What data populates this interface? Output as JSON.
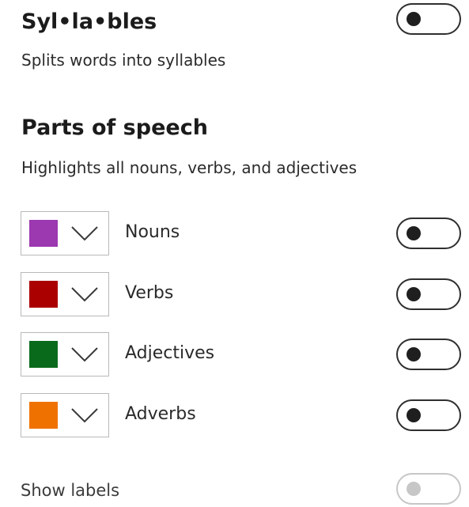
{
  "syllables": {
    "title": "Syl•la•bles",
    "description": "Splits words into syllables",
    "toggle_on": false
  },
  "parts_of_speech": {
    "title": "Parts of speech",
    "description": "Highlights all nouns, verbs, and adjectives",
    "items": [
      {
        "label": "Nouns",
        "color": "#9c38b0",
        "toggle_on": false
      },
      {
        "label": "Verbs",
        "color": "#aa0000",
        "toggle_on": false
      },
      {
        "label": "Adjectives",
        "color": "#0a6a1c",
        "toggle_on": false
      },
      {
        "label": "Adverbs",
        "color": "#ef7100",
        "toggle_on": false
      }
    ]
  },
  "show_labels": {
    "label": "Show labels",
    "toggle_on": false,
    "disabled": true
  },
  "icons": {
    "dropdown": "chevron-down-icon"
  }
}
